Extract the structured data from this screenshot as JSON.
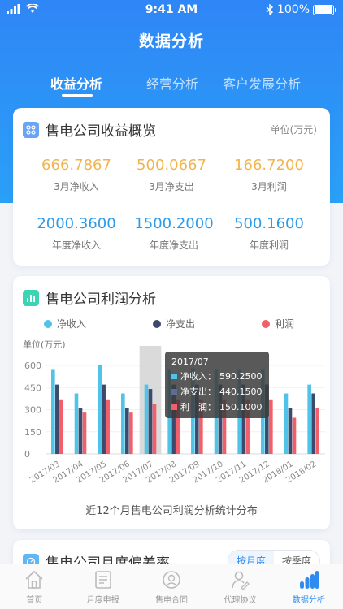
{
  "status": {
    "time": "9:41 AM",
    "battery": "100%"
  },
  "nav": {
    "title": "数据分析"
  },
  "tabs": [
    {
      "label": "收益分析",
      "active": true
    },
    {
      "label": "经营分析",
      "active": false
    },
    {
      "label": "客户发展分析",
      "active": false
    }
  ],
  "overview": {
    "title": "售电公司收益概览",
    "unit": "单位(万元)",
    "monthly": [
      {
        "value": "666.7867",
        "label": "3月净收入"
      },
      {
        "value": "500.0667",
        "label": "3月净支出"
      },
      {
        "value": "166.7200",
        "label": "3月利润"
      }
    ],
    "yearly": [
      {
        "value": "2000.3600",
        "label": "年度净收入"
      },
      {
        "value": "1500.2000",
        "label": "年度净支出"
      },
      {
        "value": "500.1600",
        "label": "年度利润"
      }
    ]
  },
  "profit_card": {
    "title": "售电公司利润分析",
    "caption": "近12个月售电公司利润分析统计分布",
    "tooltip": {
      "title": "2017/07",
      "rows": [
        {
          "label": "净收入：",
          "value": "590.2500"
        },
        {
          "label": "净支出：",
          "value": "440.1500"
        },
        {
          "label": "利　润：",
          "value": "150.1000"
        }
      ]
    }
  },
  "chart_data": {
    "type": "bar",
    "ylabel": "单位(万元)",
    "ylim": [
      0,
      600
    ],
    "yticks": [
      "0",
      "150",
      "300",
      "450",
      "600"
    ],
    "categories": [
      "2017/03",
      "2017/04",
      "2017/05",
      "2017/06",
      "2017/07",
      "2017/08",
      "2017/09",
      "2017/10",
      "2017/11",
      "2017/12",
      "2018/01",
      "2018/02"
    ],
    "series": [
      {
        "name": "净收入",
        "color": "#4fc3e8",
        "values": [
          570,
          410,
          600,
          410,
          470,
          570,
          580,
          570,
          570,
          570,
          410,
          470
        ]
      },
      {
        "name": "净支出",
        "color": "#3d4a6b",
        "values": [
          470,
          310,
          470,
          310,
          440,
          470,
          470,
          470,
          470,
          470,
          310,
          410
        ]
      },
      {
        "name": "利润",
        "color": "#f25f6a",
        "values": [
          370,
          280,
          370,
          280,
          340,
          370,
          370,
          370,
          370,
          370,
          245,
          310
        ]
      }
    ],
    "highlight": "2017/07"
  },
  "deviation_card": {
    "title": "售电公司月度偏差率",
    "toggle": [
      "按月度",
      "按季度"
    ]
  },
  "tabbar": [
    {
      "label": "首页",
      "icon": "home-icon",
      "active": false
    },
    {
      "label": "月度申报",
      "icon": "report-icon",
      "active": false
    },
    {
      "label": "售电合同",
      "icon": "contract-icon",
      "active": false
    },
    {
      "label": "代理协议",
      "icon": "agreement-icon",
      "active": false
    },
    {
      "label": "数据分析",
      "icon": "analytics-icon",
      "active": true
    }
  ],
  "colors": {
    "primary": "#2e8cf0",
    "orange": "#f2b44c",
    "blue_value": "#2e9be8"
  }
}
